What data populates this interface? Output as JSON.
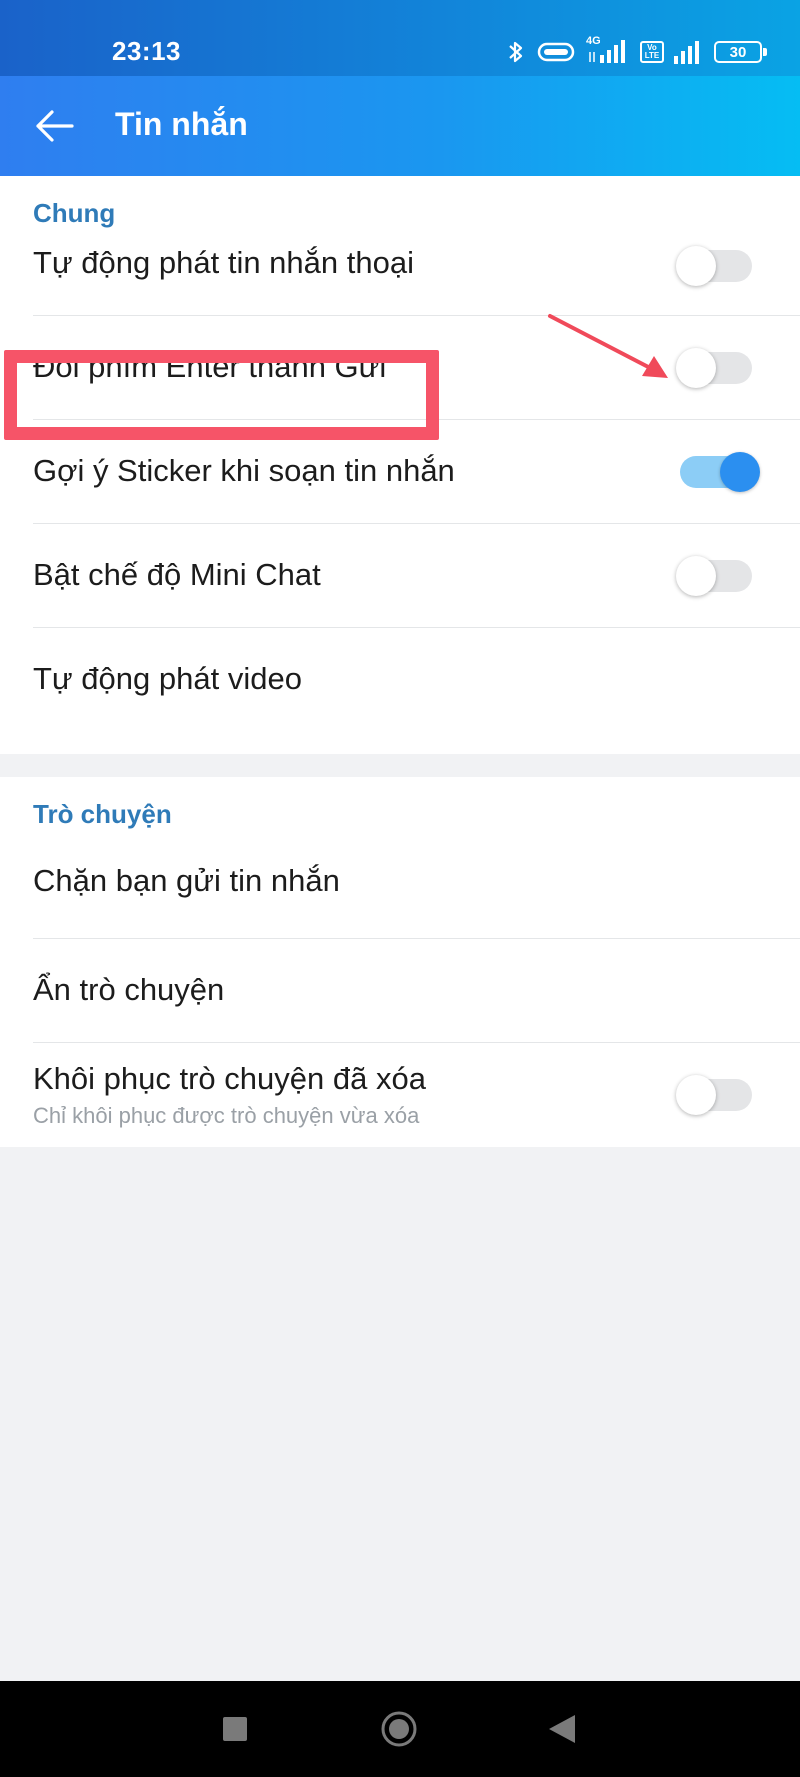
{
  "status_bar": {
    "time": "23:13",
    "network_label": "4G",
    "volte_label": "Vo LTE",
    "battery_level": "30"
  },
  "app_bar": {
    "title": "Tin nhắn",
    "back_icon": "arrow-left-icon"
  },
  "sections": [
    {
      "header": "Chung",
      "rows": [
        {
          "label": "Tự động phát tin nhắn thoại",
          "toggle": false
        },
        {
          "label": "Đổi phím Enter thành Gửi",
          "toggle": false
        },
        {
          "label": "Gợi ý Sticker khi soạn tin nhắn",
          "toggle": true
        },
        {
          "label": "Bật chế độ Mini Chat",
          "toggle": false
        },
        {
          "label": "Tự động phát video"
        }
      ]
    },
    {
      "header": "Trò chuyện",
      "rows": [
        {
          "label": "Chặn bạn gửi tin nhắn"
        },
        {
          "label": "Ẩn trò chuyện"
        },
        {
          "label": "Khôi phục trò chuyện đã xóa",
          "sublabel": "Chỉ khôi phục được trò chuyện vừa xóa",
          "toggle": false
        }
      ]
    }
  ],
  "colors": {
    "accent": "#2b8ff0",
    "section_header": "#2f7bb8",
    "annotation": "#f65468"
  },
  "nav_bar": {
    "icons": [
      "square-recent-apps-icon",
      "circle-home-icon",
      "triangle-back-icon"
    ]
  }
}
